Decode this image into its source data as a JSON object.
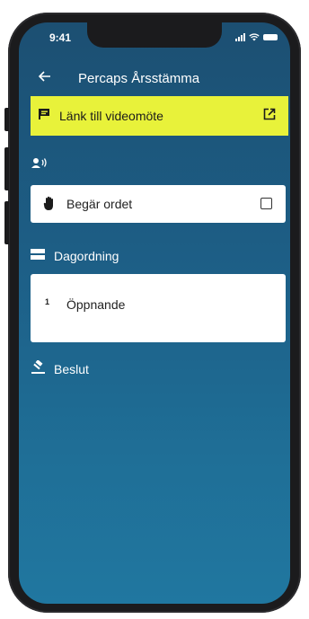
{
  "status_bar": {
    "time": "9:41"
  },
  "app_bar": {
    "title": "Percaps Årsstämma"
  },
  "video_link": {
    "label": "Länk till videomöte"
  },
  "request_word": {
    "label": "Begär ordet",
    "checked": false
  },
  "agenda": {
    "heading": "Dagordning",
    "items": [
      {
        "number": "1",
        "title": "Öppnande"
      }
    ]
  },
  "decisions": {
    "heading": "Beslut"
  },
  "colors": {
    "accent": "#e8f23a",
    "background_top": "#1c4f72",
    "background_bottom": "#2077a0",
    "card": "#ffffff"
  },
  "icons": [
    "back-arrow-icon",
    "flag-icon",
    "open-external-icon",
    "speaker-icon",
    "raised-hand-icon",
    "checkbox-icon",
    "list-icon",
    "gavel-icon"
  ]
}
